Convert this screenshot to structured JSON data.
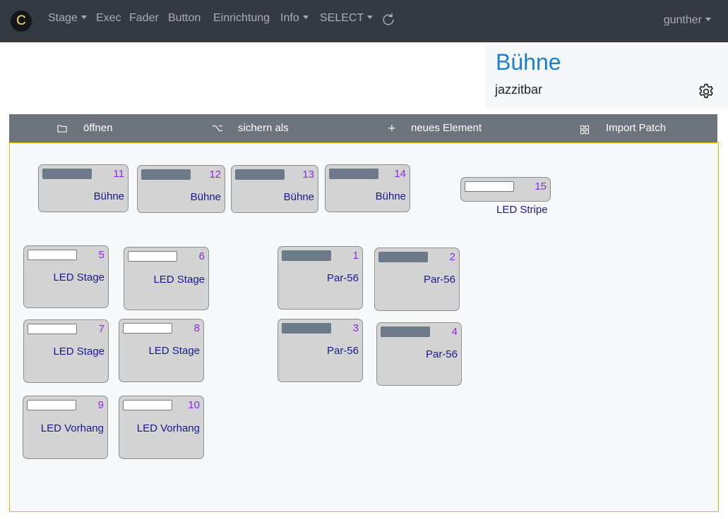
{
  "nav": {
    "logo": "C",
    "items": [
      {
        "label": "Stage",
        "dropdown": true
      },
      {
        "label": "Exec",
        "dropdown": false
      },
      {
        "label": "Fader",
        "dropdown": false
      },
      {
        "label": "Button",
        "dropdown": false
      },
      {
        "label": "Einrichtung",
        "dropdown": false
      },
      {
        "label": "Info",
        "dropdown": true
      },
      {
        "label": "SELECT",
        "dropdown": true
      }
    ],
    "refresh_icon": "refresh-icon",
    "user": "gunther"
  },
  "header": {
    "title": "Bühne",
    "subtitle": "jazzitbar",
    "settings_icon": "gear-icon"
  },
  "toolbar": {
    "open": {
      "icon": "folder-icon",
      "label": "öffnen"
    },
    "save_as": {
      "icon": "option-icon",
      "label": "sichern als"
    },
    "new_element": {
      "icon": "plus-icon",
      "label": "neues Element"
    },
    "import_patch": {
      "icon": "grid-icon",
      "label": "Import Patch"
    }
  },
  "colors": {
    "accent": "#1a7fd6",
    "navbar": "#343a40",
    "toolbar": "#6c757d",
    "canvas_border": "#f0b400",
    "fixture_number": "#8a2be2",
    "fixture_label": "#1a1a8f"
  },
  "fixtures": [
    {
      "number": "11",
      "label": "Bühne",
      "bar": "dark"
    },
    {
      "number": "12",
      "label": "Bühne",
      "bar": "dark"
    },
    {
      "number": "13",
      "label": "Bühne",
      "bar": "dark"
    },
    {
      "number": "14",
      "label": "Bühne",
      "bar": "dark"
    },
    {
      "number": "15",
      "label": "LED Stripe",
      "bar": "light"
    },
    {
      "number": "5",
      "label": "LED Stage",
      "bar": "light"
    },
    {
      "number": "6",
      "label": "LED Stage",
      "bar": "light"
    },
    {
      "number": "1",
      "label": "Par-56",
      "bar": "dark"
    },
    {
      "number": "2",
      "label": "Par-56",
      "bar": "dark"
    },
    {
      "number": "7",
      "label": "LED Stage",
      "bar": "light"
    },
    {
      "number": "8",
      "label": "LED Stage",
      "bar": "light"
    },
    {
      "number": "3",
      "label": "Par-56",
      "bar": "dark"
    },
    {
      "number": "4",
      "label": "Par-56",
      "bar": "dark"
    },
    {
      "number": "9",
      "label": "LED Vorhang",
      "bar": "light"
    },
    {
      "number": "10",
      "label": "LED Vorhang",
      "bar": "light"
    }
  ]
}
